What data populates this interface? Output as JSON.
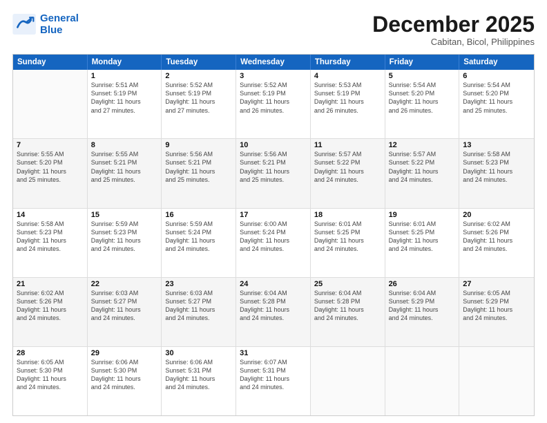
{
  "header": {
    "logo_line1": "General",
    "logo_line2": "Blue",
    "month": "December 2025",
    "location": "Cabitan, Bicol, Philippines"
  },
  "weekdays": [
    "Sunday",
    "Monday",
    "Tuesday",
    "Wednesday",
    "Thursday",
    "Friday",
    "Saturday"
  ],
  "rows": [
    [
      {
        "day": "",
        "info": ""
      },
      {
        "day": "1",
        "info": "Sunrise: 5:51 AM\nSunset: 5:19 PM\nDaylight: 11 hours\nand 27 minutes."
      },
      {
        "day": "2",
        "info": "Sunrise: 5:52 AM\nSunset: 5:19 PM\nDaylight: 11 hours\nand 27 minutes."
      },
      {
        "day": "3",
        "info": "Sunrise: 5:52 AM\nSunset: 5:19 PM\nDaylight: 11 hours\nand 26 minutes."
      },
      {
        "day": "4",
        "info": "Sunrise: 5:53 AM\nSunset: 5:19 PM\nDaylight: 11 hours\nand 26 minutes."
      },
      {
        "day": "5",
        "info": "Sunrise: 5:54 AM\nSunset: 5:20 PM\nDaylight: 11 hours\nand 26 minutes."
      },
      {
        "day": "6",
        "info": "Sunrise: 5:54 AM\nSunset: 5:20 PM\nDaylight: 11 hours\nand 25 minutes."
      }
    ],
    [
      {
        "day": "7",
        "info": "Sunrise: 5:55 AM\nSunset: 5:20 PM\nDaylight: 11 hours\nand 25 minutes."
      },
      {
        "day": "8",
        "info": "Sunrise: 5:55 AM\nSunset: 5:21 PM\nDaylight: 11 hours\nand 25 minutes."
      },
      {
        "day": "9",
        "info": "Sunrise: 5:56 AM\nSunset: 5:21 PM\nDaylight: 11 hours\nand 25 minutes."
      },
      {
        "day": "10",
        "info": "Sunrise: 5:56 AM\nSunset: 5:21 PM\nDaylight: 11 hours\nand 25 minutes."
      },
      {
        "day": "11",
        "info": "Sunrise: 5:57 AM\nSunset: 5:22 PM\nDaylight: 11 hours\nand 24 minutes."
      },
      {
        "day": "12",
        "info": "Sunrise: 5:57 AM\nSunset: 5:22 PM\nDaylight: 11 hours\nand 24 minutes."
      },
      {
        "day": "13",
        "info": "Sunrise: 5:58 AM\nSunset: 5:23 PM\nDaylight: 11 hours\nand 24 minutes."
      }
    ],
    [
      {
        "day": "14",
        "info": "Sunrise: 5:58 AM\nSunset: 5:23 PM\nDaylight: 11 hours\nand 24 minutes."
      },
      {
        "day": "15",
        "info": "Sunrise: 5:59 AM\nSunset: 5:23 PM\nDaylight: 11 hours\nand 24 minutes."
      },
      {
        "day": "16",
        "info": "Sunrise: 5:59 AM\nSunset: 5:24 PM\nDaylight: 11 hours\nand 24 minutes."
      },
      {
        "day": "17",
        "info": "Sunrise: 6:00 AM\nSunset: 5:24 PM\nDaylight: 11 hours\nand 24 minutes."
      },
      {
        "day": "18",
        "info": "Sunrise: 6:01 AM\nSunset: 5:25 PM\nDaylight: 11 hours\nand 24 minutes."
      },
      {
        "day": "19",
        "info": "Sunrise: 6:01 AM\nSunset: 5:25 PM\nDaylight: 11 hours\nand 24 minutes."
      },
      {
        "day": "20",
        "info": "Sunrise: 6:02 AM\nSunset: 5:26 PM\nDaylight: 11 hours\nand 24 minutes."
      }
    ],
    [
      {
        "day": "21",
        "info": "Sunrise: 6:02 AM\nSunset: 5:26 PM\nDaylight: 11 hours\nand 24 minutes."
      },
      {
        "day": "22",
        "info": "Sunrise: 6:03 AM\nSunset: 5:27 PM\nDaylight: 11 hours\nand 24 minutes."
      },
      {
        "day": "23",
        "info": "Sunrise: 6:03 AM\nSunset: 5:27 PM\nDaylight: 11 hours\nand 24 minutes."
      },
      {
        "day": "24",
        "info": "Sunrise: 6:04 AM\nSunset: 5:28 PM\nDaylight: 11 hours\nand 24 minutes."
      },
      {
        "day": "25",
        "info": "Sunrise: 6:04 AM\nSunset: 5:28 PM\nDaylight: 11 hours\nand 24 minutes."
      },
      {
        "day": "26",
        "info": "Sunrise: 6:04 AM\nSunset: 5:29 PM\nDaylight: 11 hours\nand 24 minutes."
      },
      {
        "day": "27",
        "info": "Sunrise: 6:05 AM\nSunset: 5:29 PM\nDaylight: 11 hours\nand 24 minutes."
      }
    ],
    [
      {
        "day": "28",
        "info": "Sunrise: 6:05 AM\nSunset: 5:30 PM\nDaylight: 11 hours\nand 24 minutes."
      },
      {
        "day": "29",
        "info": "Sunrise: 6:06 AM\nSunset: 5:30 PM\nDaylight: 11 hours\nand 24 minutes."
      },
      {
        "day": "30",
        "info": "Sunrise: 6:06 AM\nSunset: 5:31 PM\nDaylight: 11 hours\nand 24 minutes."
      },
      {
        "day": "31",
        "info": "Sunrise: 6:07 AM\nSunset: 5:31 PM\nDaylight: 11 hours\nand 24 minutes."
      },
      {
        "day": "",
        "info": ""
      },
      {
        "day": "",
        "info": ""
      },
      {
        "day": "",
        "info": ""
      }
    ]
  ]
}
